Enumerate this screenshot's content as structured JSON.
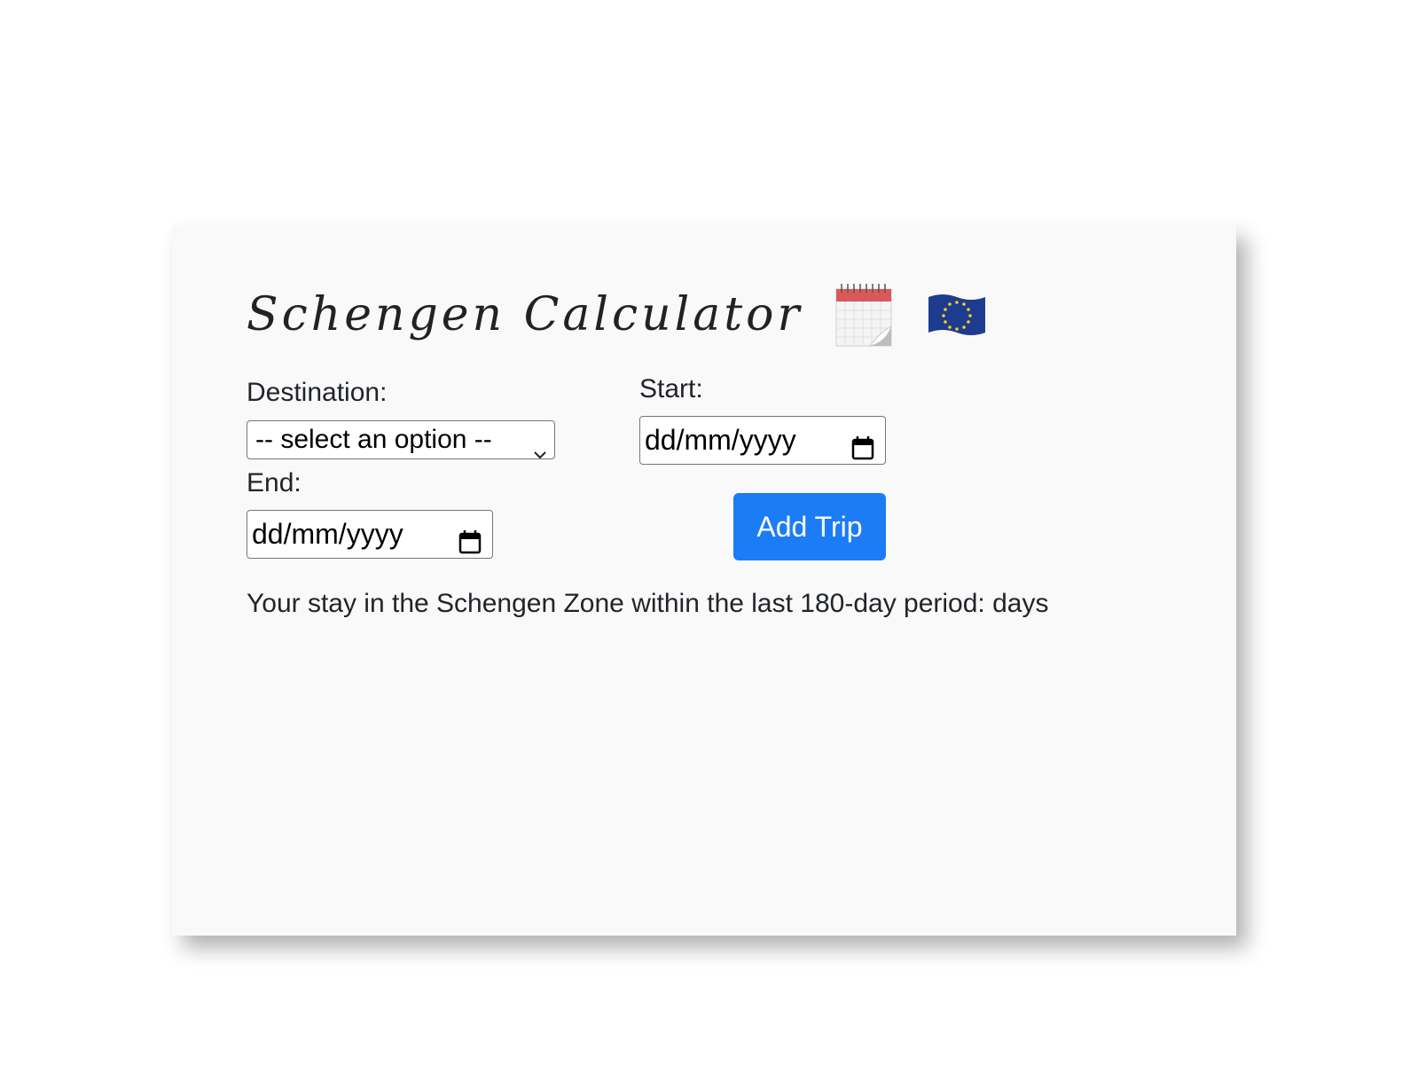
{
  "header": {
    "title": "Schengen Calculator"
  },
  "form": {
    "destination_label": "Destination:",
    "destination_value": "-- select an option --",
    "start_label": "Start:",
    "start_placeholder": "dd/mm/yyyy",
    "end_label": "End:",
    "end_placeholder": "dd/mm/yyyy",
    "add_button": "Add Trip"
  },
  "result": {
    "text": "Your stay in the Schengen Zone within the last 180-day period: days"
  },
  "icons": [
    "calendar-icon",
    "eu-flag-icon",
    "chevron-down-icon"
  ],
  "colors": {
    "accent": "#1b7cf6",
    "card_bg": "#f9f9f9",
    "flag_blue": "#1d3b8f",
    "flag_stars": "#f5cf1c"
  }
}
